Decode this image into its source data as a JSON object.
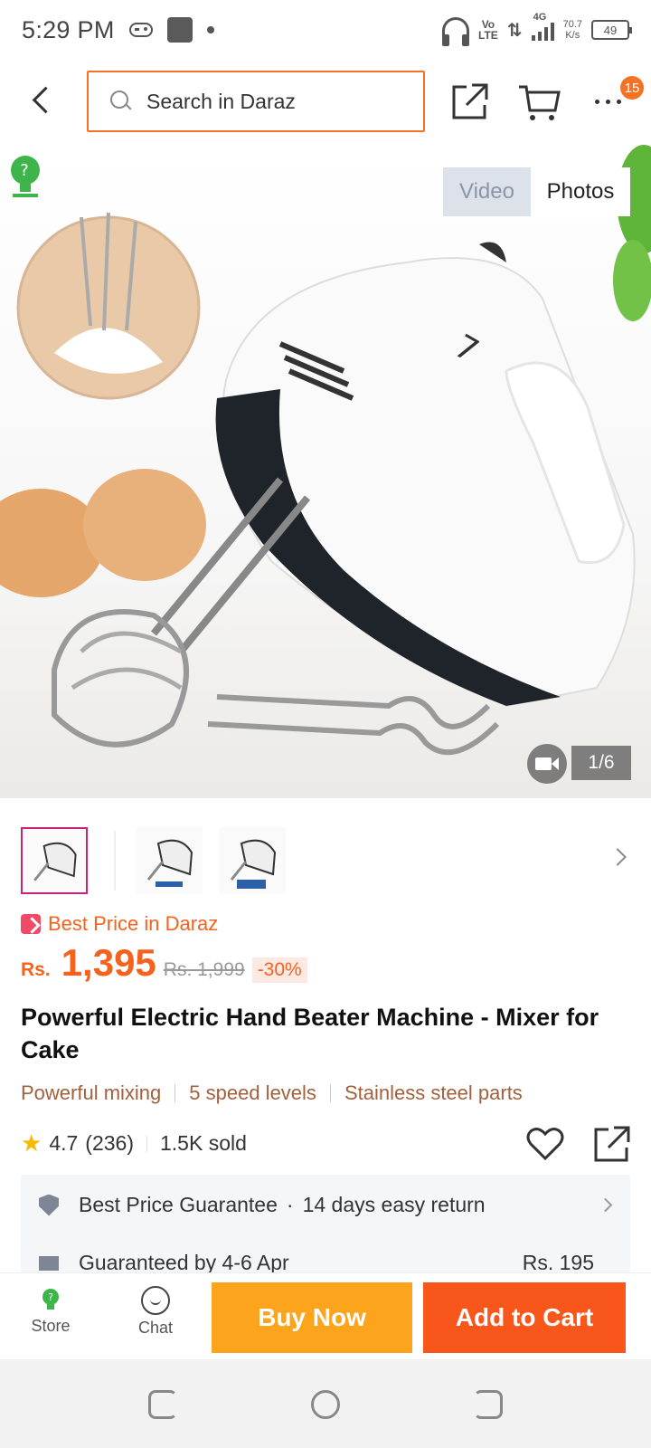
{
  "status_bar": {
    "time": "5:29 PM",
    "network_volte": "Vo\nLTE",
    "network_gen": "4G",
    "speed_value": "70.7",
    "speed_unit": "K/s",
    "battery": "49"
  },
  "header": {
    "search_placeholder": "Search in Daraz",
    "cart_badge": "15"
  },
  "gallery": {
    "tabs": [
      "Video",
      "Photos"
    ],
    "active_tab": "Photos",
    "counter": "1/6"
  },
  "price": {
    "banner": "Best Price in Daraz",
    "currency": "Rs.",
    "current": "1,395",
    "original": "Rs. 1,999",
    "discount": "-30%"
  },
  "product": {
    "title": "Powerful Electric Hand Beater Machine - Mixer for Cake",
    "features": [
      "Powerful mixing",
      "5 speed levels",
      "Stainless steel parts"
    ],
    "rating": "4.7",
    "reviews": "(236)",
    "sold": "1.5K sold"
  },
  "guarantee": {
    "best_price": "Best Price Guarantee",
    "separator": "·",
    "returns": "14 days easy return",
    "delivery": "Guaranteed by 4-6 Apr",
    "delivery_fee": "Rs. 195"
  },
  "bottom_bar": {
    "store_label": "Store",
    "chat_label": "Chat",
    "buy_now": "Buy Now",
    "add_to_cart": "Add to Cart"
  },
  "colors": {
    "accent": "#f57224",
    "buy_now": "#fca41c",
    "add_to_cart": "#f8561a",
    "feature_text": "#a3603c"
  },
  "icons": [
    "back-icon",
    "search-icon",
    "share-icon",
    "cart-icon",
    "more-icon",
    "video-camera-icon",
    "chevron-right-icon",
    "price-tag-icon",
    "star-icon",
    "heart-icon",
    "shield-icon",
    "truck-icon",
    "store-icon",
    "chat-icon"
  ]
}
